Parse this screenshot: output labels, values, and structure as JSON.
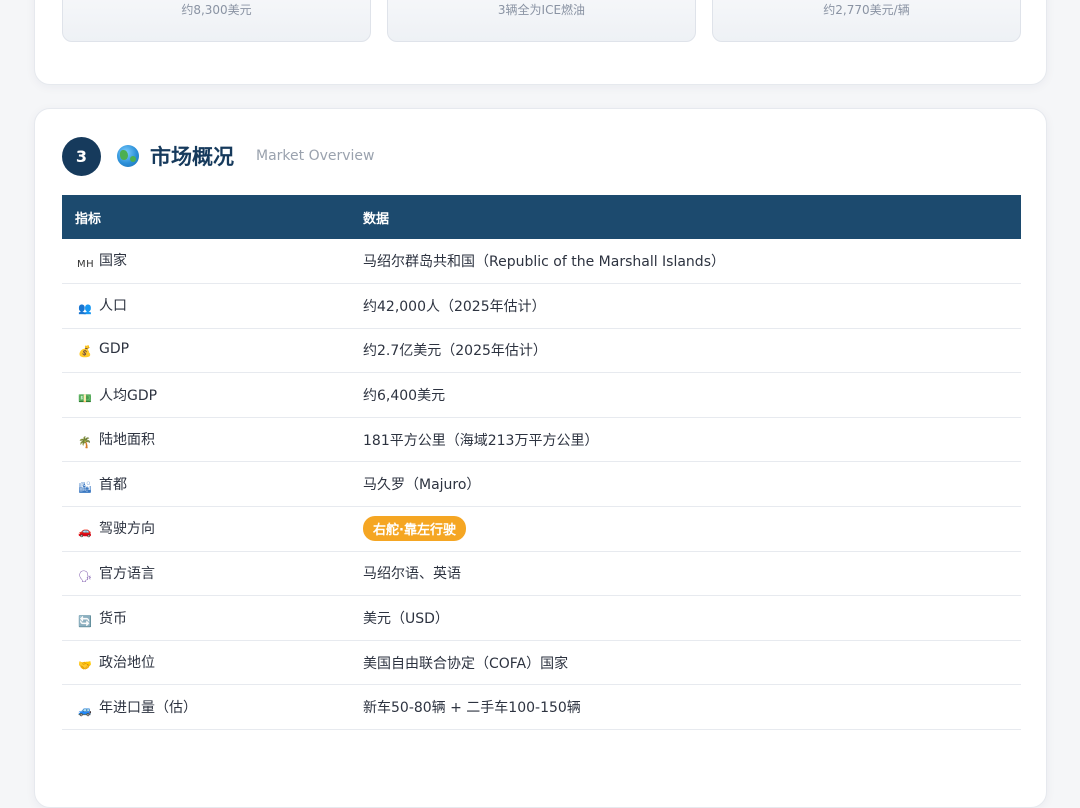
{
  "top_stats": [
    "约8,300美元",
    "3辆全为ICE燃油",
    "约2,770美元/辆"
  ],
  "section": {
    "number": "3",
    "title": "市场概况",
    "subtitle": "Market Overview"
  },
  "table": {
    "headers": [
      "指标",
      "数据"
    ],
    "rows": [
      {
        "icon": "marshall-flag-icon",
        "icon_text": "MH",
        "label": "国家",
        "value": "马绍尔群岛共和国（Republic of the Marshall Islands）"
      },
      {
        "icon": "people-icon",
        "label": "人口",
        "value": "约42,000人（2025年估计）"
      },
      {
        "icon": "money-bag-icon",
        "label": "GDP",
        "value": "约2.7亿美元（2025年估计）"
      },
      {
        "icon": "banknote-icon",
        "label": "人均GDP",
        "value": "约6,400美元"
      },
      {
        "icon": "palm-island-icon",
        "label": "陆地面积",
        "value": "181平方公里（海域213万平方公里）"
      },
      {
        "icon": "city-icon",
        "label": "首都",
        "value": "马久罗（Majuro）"
      },
      {
        "icon": "car-icon",
        "label": "驾驶方向",
        "value": "右舵·靠左行驶",
        "pill": true
      },
      {
        "icon": "speaking-head-icon",
        "label": "官方语言",
        "value": "马绍尔语、英语"
      },
      {
        "icon": "exchange-icon",
        "label": "货币",
        "value": "美元（USD）"
      },
      {
        "icon": "handshake-icon",
        "label": "政治地位",
        "value": "美国自由联合协定（COFA）国家"
      },
      {
        "icon": "blue-car-icon",
        "label": "年进口量（估）",
        "value": "新车50-80辆 + 二手车100-150辆"
      }
    ]
  },
  "colors": {
    "navy": "#163a5c",
    "header_bg": "#1c4a6e",
    "pill": "#f5a623"
  }
}
